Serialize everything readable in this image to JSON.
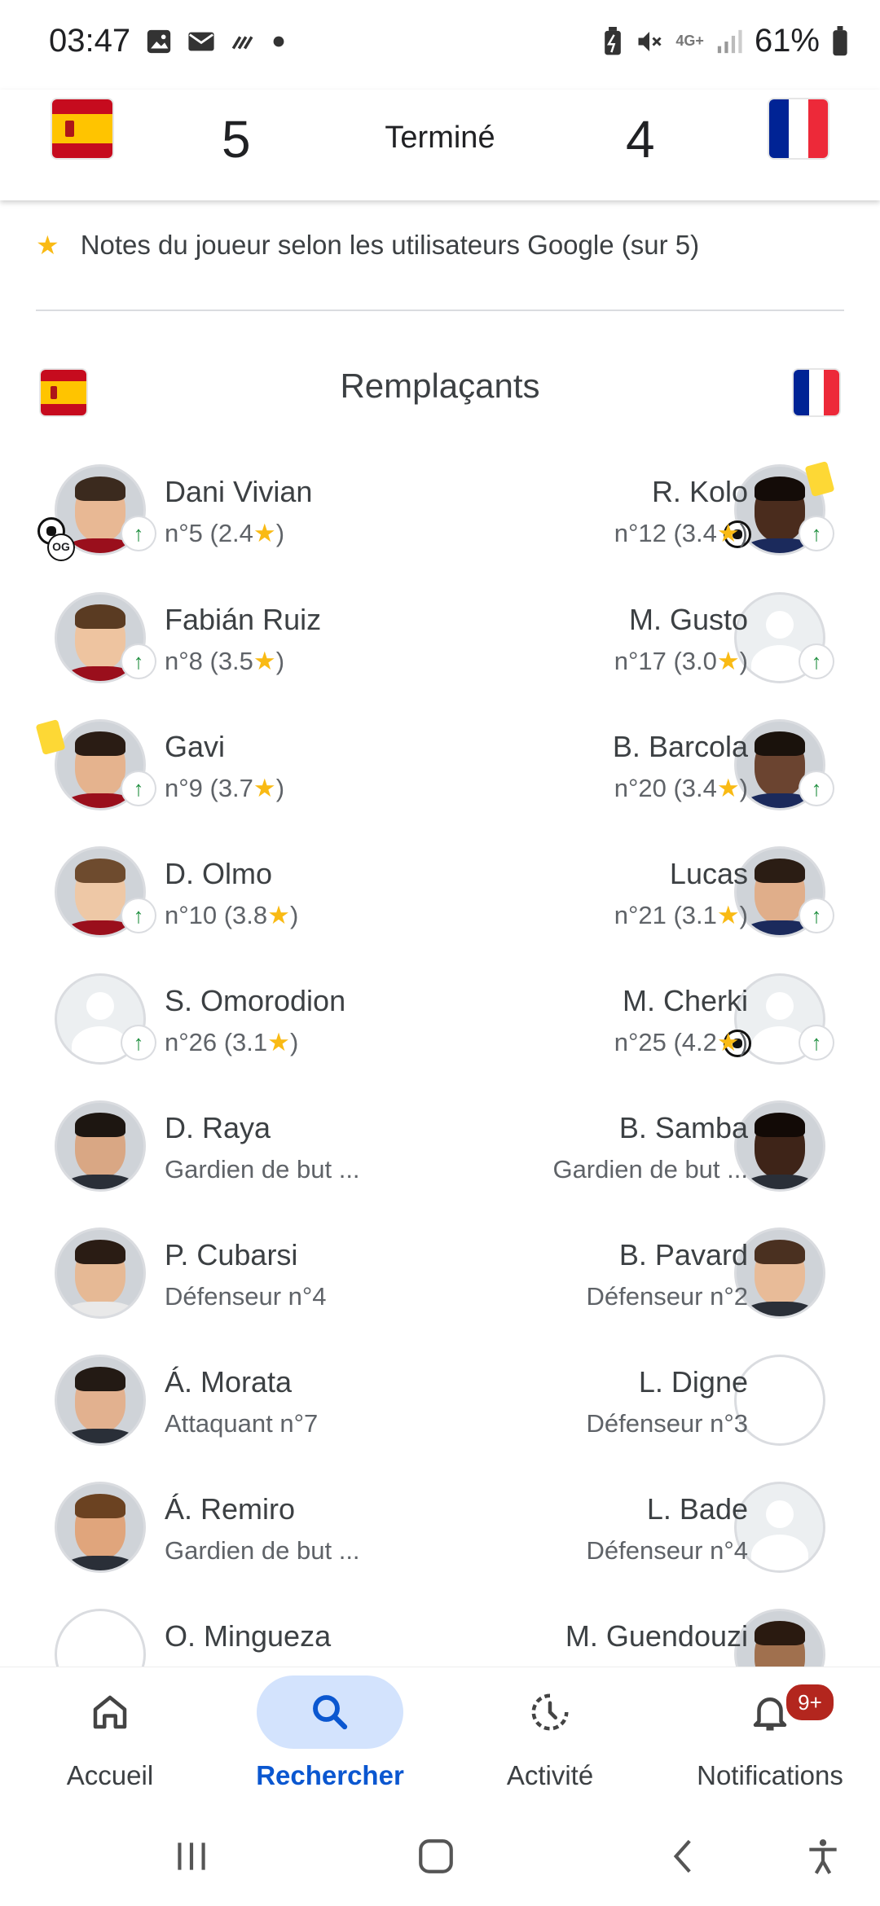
{
  "status_bar": {
    "time": "03:47",
    "network": "4G+",
    "battery": "61%",
    "icons": [
      "image-icon",
      "mail-icon",
      "missed-call-icon",
      "dot-icon",
      "battery-saver-icon",
      "mute-icon",
      "signal-icon",
      "battery-icon"
    ]
  },
  "match": {
    "home_score": "5",
    "status": "Terminé",
    "away_score": "4"
  },
  "rating_note": "Notes du joueur selon les utilisateurs Google (sur 5)",
  "section_title": "Remplaçants",
  "home_players": [
    {
      "name": "Dani Vivian",
      "info": "n°5 (2.4★)"
    },
    {
      "name": "Fabián Ruiz",
      "info": "n°8 (3.5★)"
    },
    {
      "name": "Gavi",
      "info": "n°9 (3.7★)"
    },
    {
      "name": "D. Olmo",
      "info": "n°10 (3.8★)"
    },
    {
      "name": "S. Omorodion",
      "info": "n°26 (3.1★)"
    },
    {
      "name": "D. Raya",
      "info": "Gardien de but ..."
    },
    {
      "name": "P. Cubarsi",
      "info": "Défenseur n°4"
    },
    {
      "name": "Á. Morata",
      "info": "Attaquant n°7"
    },
    {
      "name": "Á. Remiro",
      "info": "Gardien de but ..."
    },
    {
      "name": "O. Mingueza",
      "info": ""
    }
  ],
  "away_players": [
    {
      "name": "R. Kolo",
      "info": "n°12 (3.4★)"
    },
    {
      "name": "M. Gusto",
      "info": "n°17 (3.0★)"
    },
    {
      "name": "B. Barcola",
      "info": "n°20 (3.4★)"
    },
    {
      "name": "Lucas",
      "info": "n°21 (3.1★)"
    },
    {
      "name": "M. Cherki",
      "info": "n°25 (4.2★)"
    },
    {
      "name": "B. Samba",
      "info": "Gardien de but ..."
    },
    {
      "name": "B. Pavard",
      "info": "Défenseur n°2"
    },
    {
      "name": "L. Digne",
      "info": "Défenseur n°3"
    },
    {
      "name": "L. Bade",
      "info": "Défenseur n°4"
    },
    {
      "name": "M. Guendouzi",
      "info": ""
    }
  ],
  "og_label": "OG",
  "nav": {
    "home": "Accueil",
    "search": "Rechercher",
    "activity": "Activité",
    "notifications": "Notifications",
    "notif_count": "9+"
  },
  "colors": {
    "accent": "#0b57d0",
    "active_pill": "#d3e3fd",
    "sub_arrow": "#1e8e3e",
    "star": "#f9ba14",
    "yellow_card": "#fdd835",
    "badge": "#b3261e"
  }
}
